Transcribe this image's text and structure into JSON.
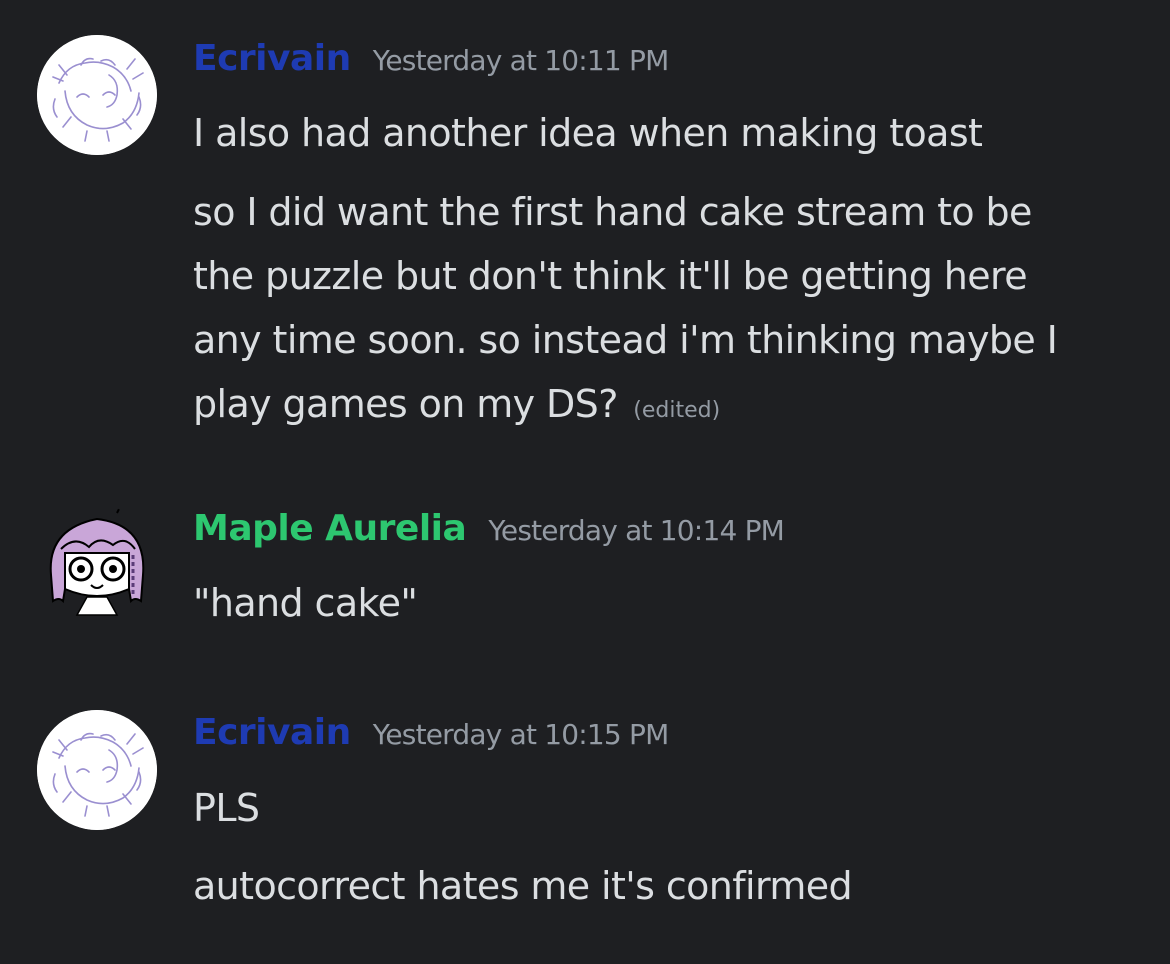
{
  "messages": [
    {
      "username": "Ecrivain",
      "username_color": "#1e3bb3",
      "timestamp": "Yesterday at 10:11 PM",
      "avatar": "sketch-avatar-icon",
      "lines": [
        "I also had another idea when making toast",
        "so I did want the first hand cake stream to be",
        "the puzzle but don't think it'll be getting here",
        "any time soon. so instead i'm thinking maybe I",
        "play games on my DS?"
      ],
      "edited_label": "(edited)"
    },
    {
      "username": "Maple Aurelia",
      "username_color": "#2dc770",
      "timestamp": "Yesterday at 10:14 PM",
      "avatar": "chibi-avatar-icon",
      "lines": [
        "\"hand cake\""
      ]
    },
    {
      "username": "Ecrivain",
      "username_color": "#1e3bb3",
      "timestamp": "Yesterday at 10:15 PM",
      "avatar": "sketch-avatar-icon",
      "lines": [
        "PLS",
        "autocorrect hates me it's confirmed"
      ]
    }
  ],
  "colors": {
    "background": "#1e1f22",
    "message_text": "#dbdee1",
    "timestamp_text": "#949ba4"
  }
}
